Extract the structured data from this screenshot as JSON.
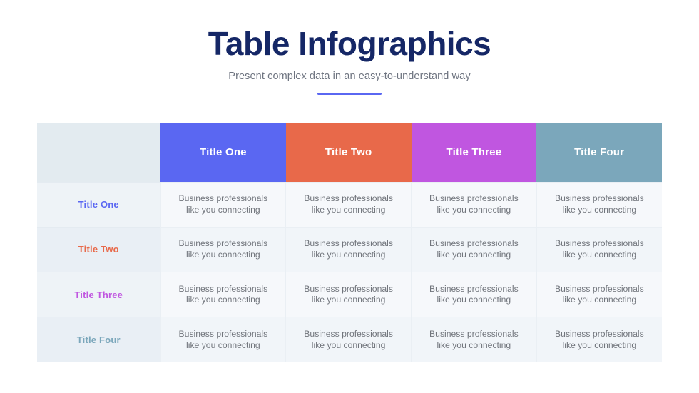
{
  "header": {
    "title": "Table Infographics",
    "subtitle": "Present complex data in an easy-to-understand way",
    "accent_color": "#5a67f2",
    "title_color": "#152766"
  },
  "table": {
    "corner_label": "",
    "columns": [
      {
        "label": "Title One",
        "color": "#5a67f2"
      },
      {
        "label": "Title Two",
        "color": "#e8694a"
      },
      {
        "label": "Title Three",
        "color": "#c056e0"
      },
      {
        "label": "Title Four",
        "color": "#7ba7bb"
      }
    ],
    "rows": [
      {
        "label": "Title One",
        "label_color": "#5a67f2",
        "cells": [
          {
            "line1": "Business professionals",
            "line2": "like you connecting"
          },
          {
            "line1": "Business professionals",
            "line2": "like you connecting"
          },
          {
            "line1": "Business professionals",
            "line2": "like you connecting"
          },
          {
            "line1": "Business professionals",
            "line2": "like you connecting"
          }
        ]
      },
      {
        "label": "Title Two",
        "label_color": "#e8694a",
        "cells": [
          {
            "line1": "Business professionals",
            "line2": "like you connecting"
          },
          {
            "line1": "Business professionals",
            "line2": "like you connecting"
          },
          {
            "line1": "Business professionals",
            "line2": "like you connecting"
          },
          {
            "line1": "Business professionals",
            "line2": "like you connecting"
          }
        ]
      },
      {
        "label": "Title Three",
        "label_color": "#c056e0",
        "cells": [
          {
            "line1": "Business professionals",
            "line2": "like you connecting"
          },
          {
            "line1": "Business professionals",
            "line2": "like you connecting"
          },
          {
            "line1": "Business professionals",
            "line2": "like you connecting"
          },
          {
            "line1": "Business professionals",
            "line2": "like you connecting"
          }
        ]
      },
      {
        "label": "Title Four",
        "label_color": "#7ba7bb",
        "cells": [
          {
            "line1": "Business professionals",
            "line2": "like you connecting"
          },
          {
            "line1": "Business professionals",
            "line2": "like you connecting"
          },
          {
            "line1": "Business professionals",
            "line2": "like you connecting"
          },
          {
            "line1": "Business professionals",
            "line2": "like you connecting"
          }
        ]
      }
    ]
  }
}
